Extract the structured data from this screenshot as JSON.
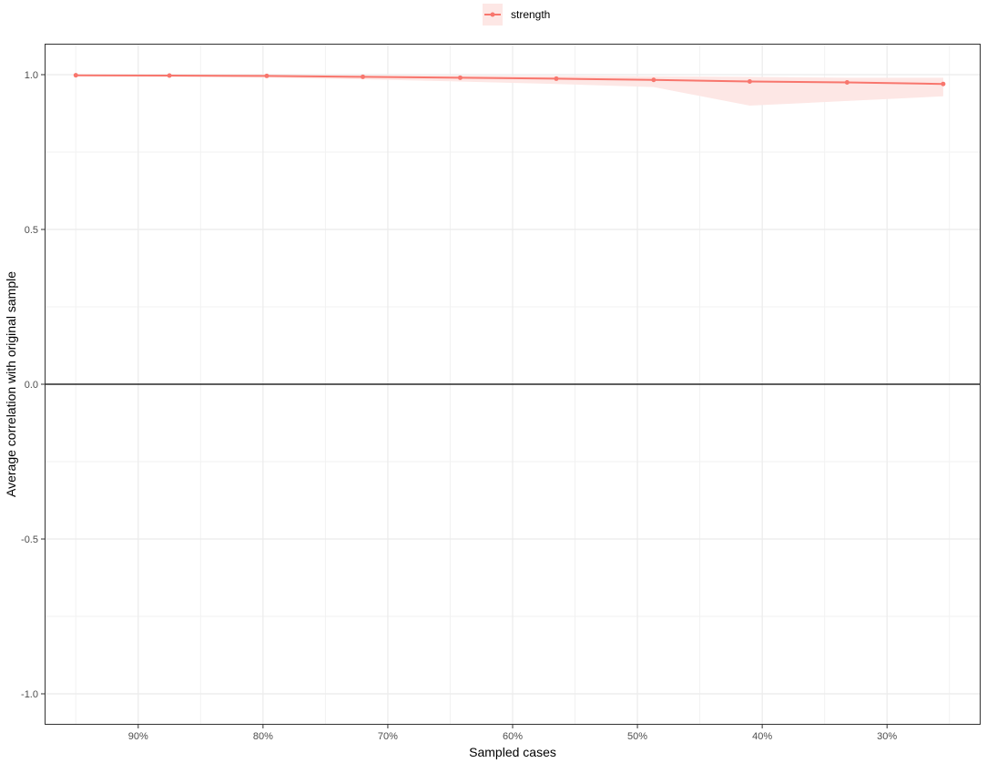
{
  "chart_data": {
    "type": "line",
    "title": "",
    "xlabel": "Sampled cases",
    "ylabel": "Average correlation with original sample",
    "x_reversed": true,
    "xlim": [
      0.225,
      0.975
    ],
    "ylim": [
      -1.1,
      1.1
    ],
    "x_ticks": [
      {
        "value": 0.9,
        "label": "90%"
      },
      {
        "value": 0.8,
        "label": "80%"
      },
      {
        "value": 0.7,
        "label": "70%"
      },
      {
        "value": 0.6,
        "label": "60%"
      },
      {
        "value": 0.5,
        "label": "50%"
      },
      {
        "value": 0.4,
        "label": "40%"
      },
      {
        "value": 0.3,
        "label": "30%"
      }
    ],
    "y_ticks": [
      {
        "value": 1.0,
        "label": "1.0"
      },
      {
        "value": 0.5,
        "label": "0.5"
      },
      {
        "value": 0.0,
        "label": "0.0"
      },
      {
        "value": -0.5,
        "label": "-0.5"
      },
      {
        "value": -1.0,
        "label": "-1.0"
      }
    ],
    "grid": true,
    "reference_line_y": 0,
    "legend_position": "top",
    "series": [
      {
        "name": "strength",
        "color": "#f8766d",
        "ribbon_color": "#fde7e5",
        "x": [
          0.95,
          0.875,
          0.797,
          0.72,
          0.642,
          0.565,
          0.487,
          0.41,
          0.332,
          0.255
        ],
        "values": [
          0.998,
          0.997,
          0.996,
          0.993,
          0.99,
          0.987,
          0.983,
          0.978,
          0.975,
          0.97
        ],
        "lower": [
          0.995,
          0.993,
          0.99,
          0.985,
          0.978,
          0.97,
          0.96,
          0.9,
          0.915,
          0.93
        ],
        "upper": [
          1.0,
          0.999,
          0.999,
          0.998,
          0.997,
          0.996,
          0.995,
          0.993,
          0.99,
          0.99
        ]
      }
    ]
  }
}
